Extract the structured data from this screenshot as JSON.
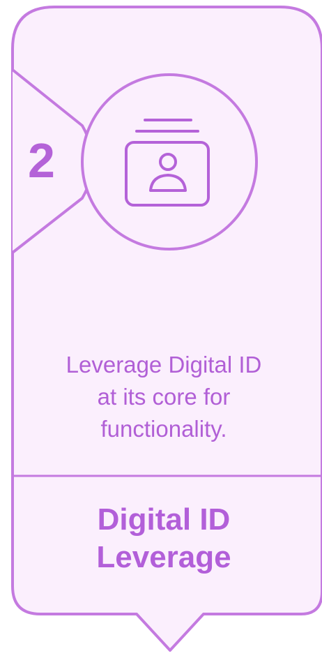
{
  "card": {
    "step_number": "2",
    "description": "Leverage Digital ID\nat its core for\nfunctionality.",
    "title": "Digital ID\nLeverage",
    "icon": "digital-id-card-icon"
  },
  "colors": {
    "accent": "#b462d8",
    "card_fill": "#fbeffd",
    "border": "#c47ae0"
  }
}
